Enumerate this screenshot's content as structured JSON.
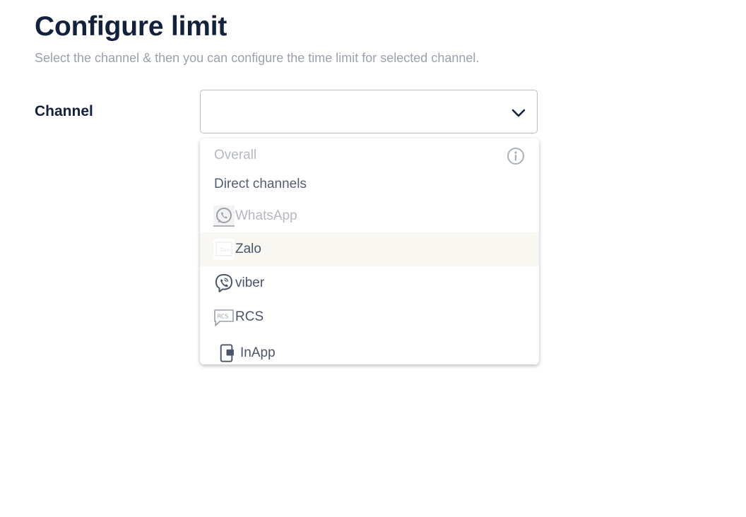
{
  "page": {
    "title": "Configure limit",
    "subtitle": "Select the channel & then you can configure the time limit for selected channel."
  },
  "form": {
    "channel_label": "Channel",
    "channel_value": ""
  },
  "dropdown": {
    "overall_label": "Overall",
    "group_label": "Direct channels",
    "items": [
      {
        "label": "WhatsApp",
        "icon": "whatsapp-icon",
        "disabled": true
      },
      {
        "label": "Zalo",
        "icon": "zalo-icon",
        "highlighted": true
      },
      {
        "label": "viber",
        "icon": "viber-icon"
      },
      {
        "label": "RCS",
        "icon": "rcs-icon"
      },
      {
        "label": "InApp",
        "icon": "inapp-icon"
      }
    ]
  },
  "colors": {
    "title": "#14213d",
    "subtitle": "#9aa1ab",
    "option_text": "#4a5568",
    "disabled_text": "#b4b8bf",
    "highlight_bg": "#f8f7f2"
  }
}
